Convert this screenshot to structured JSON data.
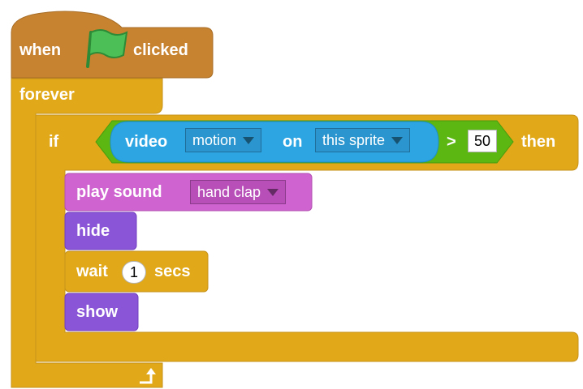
{
  "script": {
    "hat": {
      "when": "when",
      "clicked": "clicked",
      "icon": "green-flag-icon"
    },
    "forever": {
      "label": "forever",
      "loop_icon": "loop-arrow-icon"
    },
    "if_block": {
      "if": "if",
      "then": "then",
      "sensor": {
        "video": "video",
        "attribute": "motion",
        "on": "on",
        "target": "this sprite"
      },
      "operator": ">",
      "threshold": "50"
    },
    "actions": {
      "play_sound": {
        "label": "play sound",
        "sound": "hand clap"
      },
      "hide": "hide",
      "wait": {
        "label_before": "wait",
        "seconds": "1",
        "label_after": "secs"
      },
      "show": "show"
    }
  },
  "colors": {
    "events": "#C88330",
    "control": "#E1A91A",
    "sound": "#CF63CF",
    "looks": "#8A55D7",
    "sensing": "#2CA5E2",
    "operators": "#5CB712",
    "flag": "#4CBF56"
  }
}
